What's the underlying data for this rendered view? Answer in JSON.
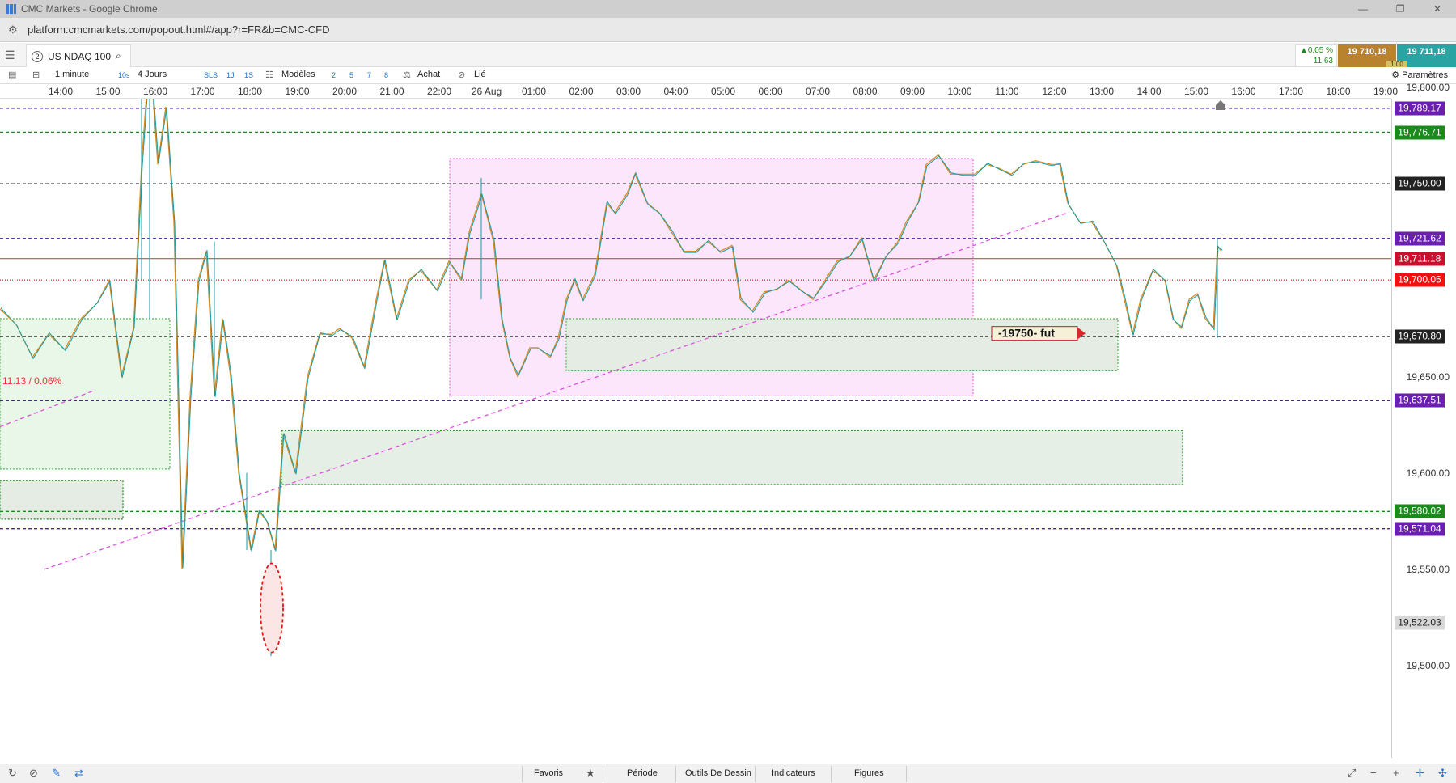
{
  "browser": {
    "window_title": "CMC Markets - Google Chrome",
    "url": "platform.cmcmarkets.com/popout.html#/app?r=FR&b=CMC-CFD"
  },
  "instrument": {
    "tab_number": "2",
    "name": "US NDAQ 100",
    "change_pct": "▲0,05 %",
    "change_pts": "11,63",
    "sell_price": "19 710,18",
    "buy_price": "19 711,18",
    "spread": "1.00"
  },
  "toolbar": {
    "interval": "1 minute",
    "interval_short": "10s",
    "range": "4 Jours",
    "sls": "SLS",
    "one_j": "1J",
    "one_s": "1S",
    "models": "Modèles",
    "n2": "2",
    "n5": "5",
    "n7": "7",
    "n8": "8",
    "buy": "Achat",
    "linked": "Lié",
    "settings": "Paramètres"
  },
  "time_axis": [
    "14:00",
    "15:00",
    "16:00",
    "17:00",
    "18:00",
    "19:00",
    "20:00",
    "21:00",
    "22:00",
    "26 Aug",
    "01:00",
    "02:00",
    "03:00",
    "04:00",
    "05:00",
    "06:00",
    "07:00",
    "08:00",
    "09:00",
    "10:00",
    "11:00",
    "12:00",
    "13:00",
    "14:00",
    "15:00",
    "16:00",
    "17:00",
    "18:00",
    "19:00"
  ],
  "price_axis": [
    "19,800.00",
    "19,650.00",
    "19,600.00",
    "19,550.00",
    "19,500.00"
  ],
  "price_tags": [
    {
      "label": "19,789.17",
      "color": "#6a1fb0"
    },
    {
      "label": "19,776.71",
      "color": "#1a8a1a"
    },
    {
      "label": "19,750.00",
      "color": "#222222"
    },
    {
      "label": "19,721.62",
      "color": "#6a1fb0"
    },
    {
      "label": "19,711.18",
      "color": "#c8102e"
    },
    {
      "label": "19,700.05",
      "color": "#ee1111"
    },
    {
      "label": "19,670.80",
      "color": "#222222"
    },
    {
      "label": "19,637.51",
      "color": "#6a1fb0"
    },
    {
      "label": "19,580.02",
      "color": "#1a8a1a"
    },
    {
      "label": "19,571.04",
      "color": "#6a1fb0"
    },
    {
      "label": "19,522.03",
      "color": "#d8d8d8"
    }
  ],
  "annotations": {
    "box_label": "-19750- fut",
    "pct_label": "11.13 / 0.06%"
  },
  "colors": {
    "candle_up": "#1a9aa0",
    "candle_down": "#d98a1e",
    "purple_line": "#4b1fa6",
    "green_line": "#1a8a1a",
    "red_line": "#d42a2a",
    "pink_dash": "#e050e0"
  },
  "statusbar": {
    "favorites": "Favoris",
    "period": "Période",
    "drawing_tools": "Outils De Dessin",
    "indicators": "Indicateurs",
    "figures": "Figures"
  }
}
